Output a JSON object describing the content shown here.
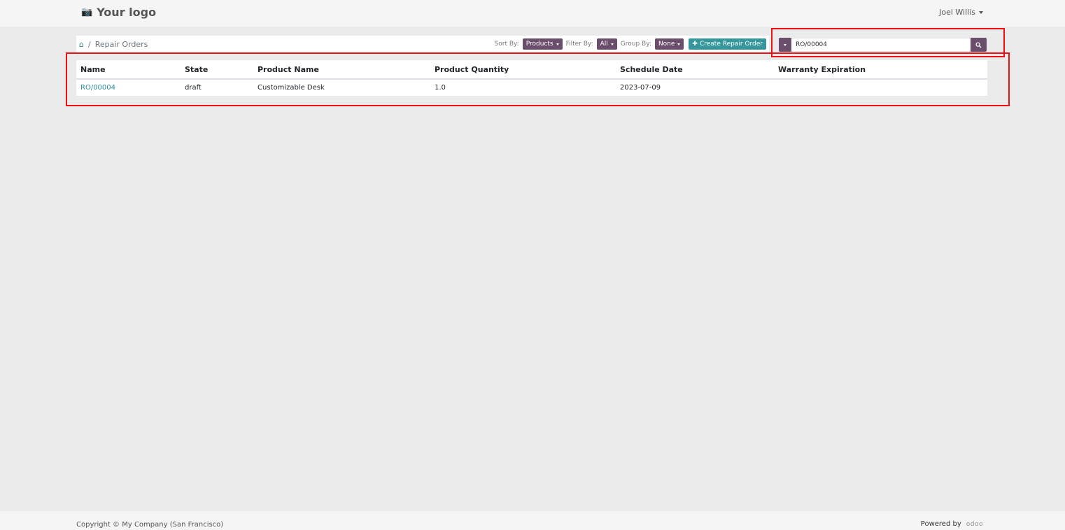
{
  "navbar": {
    "logo_text": "Your logo",
    "logo_icon": "camera-icon",
    "user_name": "Joel Willis"
  },
  "breadcrumb": {
    "home_icon": "home-icon",
    "separator": "/",
    "current": "Repair Orders"
  },
  "controls": {
    "sort_label": "Sort By:",
    "sort_value": "Products",
    "filter_label": "Filter By:",
    "filter_value": "All",
    "group_label": "Group By:",
    "group_value": "None",
    "create_label": "Create Repair Order",
    "create_icon": "plus-icon"
  },
  "search": {
    "value": "RO/00004",
    "button_icon": "search-icon"
  },
  "table": {
    "headers": [
      "Name",
      "State",
      "Product Name",
      "Product Quantity",
      "Schedule Date",
      "Warranty Expiration"
    ],
    "rows": [
      [
        "RO/00004",
        "draft",
        "Customizable Desk",
        "1.0",
        "2023-07-09",
        ""
      ]
    ]
  },
  "highlight_color": "#ee1111",
  "accent_color": "#6b4e6b",
  "create_button_color": "#35979c",
  "footer": {
    "copyright": "Copyright © My Company (San Francisco)",
    "powered_by": "Powered by",
    "brand": "odoo"
  }
}
